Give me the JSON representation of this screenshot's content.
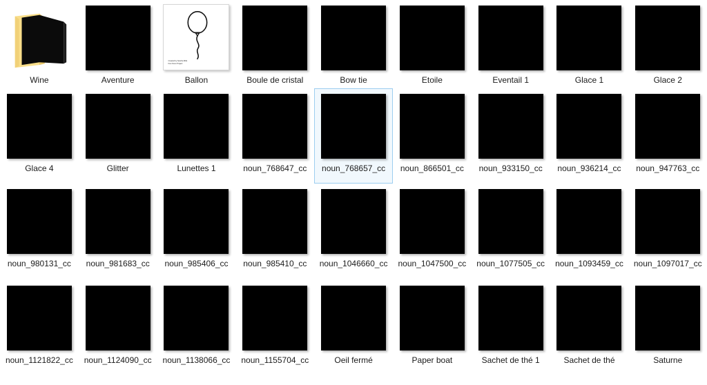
{
  "view": {
    "name": "file-explorer-icon-grid",
    "background_color": "#ffffff",
    "label_color": "#1b1b1b",
    "selection_border_color": "#9ccdef",
    "selection_fill_color": "#f1f8fd",
    "thumbnail_color": "#000000",
    "folder_color": "#f9de8a",
    "columns": 9,
    "rows": 4
  },
  "items": [
    {
      "label": "Wine",
      "type": "folder",
      "icon": "open-folder-icon",
      "selected": false
    },
    {
      "label": "Aventure",
      "type": "image",
      "icon": "black-thumbnail",
      "selected": false
    },
    {
      "label": "Ballon",
      "type": "image",
      "icon": "balloon-line-art-thumbnail",
      "selected": false,
      "art_credit": "Created by Sandra Mills\nfrom Noun Project"
    },
    {
      "label": "Boule de cristal",
      "type": "image",
      "icon": "black-thumbnail",
      "selected": false
    },
    {
      "label": "Bow tie",
      "type": "image",
      "icon": "black-thumbnail",
      "selected": false
    },
    {
      "label": "Etoile",
      "type": "image",
      "icon": "black-thumbnail",
      "selected": false
    },
    {
      "label": "Eventail 1",
      "type": "image",
      "icon": "black-thumbnail",
      "selected": false
    },
    {
      "label": "Glace 1",
      "type": "image",
      "icon": "black-thumbnail",
      "selected": false
    },
    {
      "label": "Glace 2",
      "type": "image",
      "icon": "black-thumbnail",
      "selected": false
    },
    {
      "label": "Glace 4",
      "type": "image",
      "icon": "black-thumbnail",
      "selected": false
    },
    {
      "label": "Glitter",
      "type": "image",
      "icon": "black-thumbnail",
      "selected": false
    },
    {
      "label": "Lunettes 1",
      "type": "image",
      "icon": "black-thumbnail",
      "selected": false
    },
    {
      "label": "noun_768647_cc",
      "type": "image",
      "icon": "black-thumbnail",
      "selected": false
    },
    {
      "label": "noun_768657_cc",
      "type": "image",
      "icon": "black-thumbnail",
      "selected": true
    },
    {
      "label": "noun_866501_cc",
      "type": "image",
      "icon": "black-thumbnail",
      "selected": false
    },
    {
      "label": "noun_933150_cc",
      "type": "image",
      "icon": "black-thumbnail",
      "selected": false
    },
    {
      "label": "noun_936214_cc",
      "type": "image",
      "icon": "black-thumbnail",
      "selected": false
    },
    {
      "label": "noun_947763_cc",
      "type": "image",
      "icon": "black-thumbnail",
      "selected": false
    },
    {
      "label": "noun_980131_cc",
      "type": "image",
      "icon": "black-thumbnail",
      "selected": false
    },
    {
      "label": "noun_981683_cc",
      "type": "image",
      "icon": "black-thumbnail",
      "selected": false
    },
    {
      "label": "noun_985406_cc",
      "type": "image",
      "icon": "black-thumbnail",
      "selected": false
    },
    {
      "label": "noun_985410_cc",
      "type": "image",
      "icon": "black-thumbnail",
      "selected": false
    },
    {
      "label": "noun_1046660_cc",
      "type": "image",
      "icon": "black-thumbnail",
      "selected": false
    },
    {
      "label": "noun_1047500_cc",
      "type": "image",
      "icon": "black-thumbnail",
      "selected": false
    },
    {
      "label": "noun_1077505_cc",
      "type": "image",
      "icon": "black-thumbnail",
      "selected": false
    },
    {
      "label": "noun_1093459_cc",
      "type": "image",
      "icon": "black-thumbnail",
      "selected": false
    },
    {
      "label": "noun_1097017_cc",
      "type": "image",
      "icon": "black-thumbnail",
      "selected": false
    },
    {
      "label": "noun_1121822_cc",
      "type": "image",
      "icon": "black-thumbnail",
      "selected": false
    },
    {
      "label": "noun_1124090_cc",
      "type": "image",
      "icon": "black-thumbnail",
      "selected": false
    },
    {
      "label": "noun_1138066_cc",
      "type": "image",
      "icon": "black-thumbnail",
      "selected": false
    },
    {
      "label": "noun_1155704_cc",
      "type": "image",
      "icon": "black-thumbnail",
      "selected": false
    },
    {
      "label": "Oeil fermé",
      "type": "image",
      "icon": "black-thumbnail",
      "selected": false
    },
    {
      "label": "Paper boat",
      "type": "image",
      "icon": "black-thumbnail",
      "selected": false
    },
    {
      "label": "Sachet de thé 1",
      "type": "image",
      "icon": "black-thumbnail",
      "selected": false
    },
    {
      "label": "Sachet de thé",
      "type": "image",
      "icon": "black-thumbnail",
      "selected": false
    },
    {
      "label": "Saturne",
      "type": "image",
      "icon": "black-thumbnail",
      "selected": false
    }
  ]
}
